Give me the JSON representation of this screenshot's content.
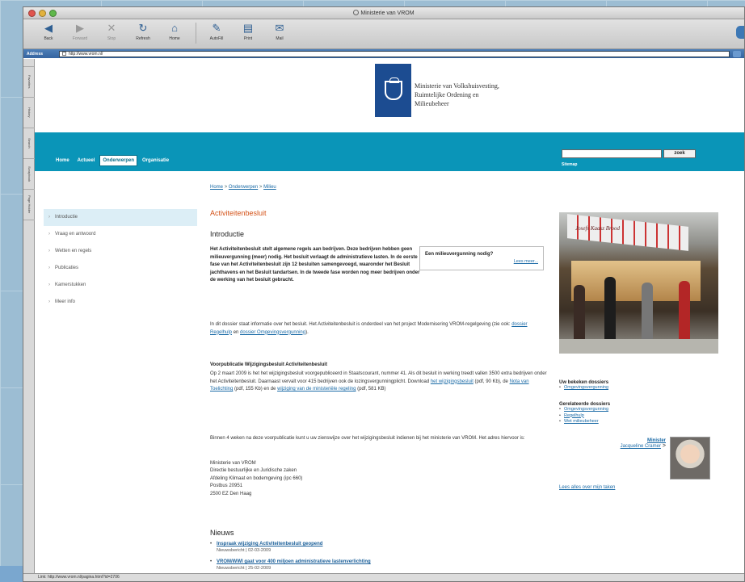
{
  "browser": {
    "window_title": "Ministerie van VROM",
    "toolbar": [
      {
        "label": "Back",
        "icon": "back-arrow-icon",
        "enabled": true
      },
      {
        "label": "Forward",
        "icon": "forward-arrow-icon",
        "enabled": false
      },
      {
        "label": "Stop",
        "icon": "stop-icon",
        "enabled": false
      },
      {
        "label": "Refresh",
        "icon": "refresh-icon",
        "enabled": true
      },
      {
        "label": "Home",
        "icon": "home-icon",
        "enabled": true
      },
      {
        "label": "AutoFill",
        "icon": "autofill-icon",
        "enabled": true
      },
      {
        "label": "Print",
        "icon": "print-icon",
        "enabled": true
      },
      {
        "label": "Mail",
        "icon": "mail-icon",
        "enabled": true
      }
    ],
    "address_label": "Address",
    "address_value": "http://www.vrom.nl/",
    "side_tabs": [
      "Favorites",
      "History",
      "Search",
      "Scrapbook",
      "Page Holder"
    ],
    "status_text": "Link: http://www.vrom.nl/pagina.html?id=2706"
  },
  "site": {
    "ministry_name": [
      "Ministerie van Volkshuisvesting,",
      "Ruimtelijke Ordening en",
      "Milieubeheer"
    ],
    "nav": [
      {
        "label": "Home",
        "active": false
      },
      {
        "label": "Actueel",
        "active": false
      },
      {
        "label": "Onderwerpen",
        "active": true
      },
      {
        "label": "Organisatie",
        "active": false
      }
    ],
    "search_button": "zoek",
    "sitemap": "Sitemap",
    "breadcrumb": {
      "home": "Home",
      "sep1": ">",
      "onderwerpen": "Onderwerpen",
      "sep2": ">",
      "milieu": "Milieu"
    },
    "leftnav": [
      {
        "label": "Introductie",
        "active": true
      },
      {
        "label": "Vraag en antwoord",
        "active": false
      },
      {
        "label": "Wetten en regels",
        "active": false
      },
      {
        "label": "Publicaties",
        "active": false
      },
      {
        "label": "Kamerstukken",
        "active": false
      },
      {
        "label": "Meer info",
        "active": false
      }
    ],
    "page_title": "Activiteitenbesluit",
    "section_title": "Introductie",
    "intro_bold": "Het Activiteitenbesluit stelt algemene regels aan bedrijven. Deze bedrijven hebben geen milieuvergunning (meer) nodig. Het besluit verlaagt de administratieve lasten. In de eerste fase van het Activiteitenbesluit zijn 12 besluiten samengevoegd, waaronder het Besluit jachthavens en het Besluit tandartsen. In de tweede fase worden nog meer bedrijven onder de werking van het besluit gebracht.",
    "callout": {
      "question": "Een milieuvergunning nodig?",
      "more": "Lees meer..."
    },
    "para1_a": "In dit dossier staat informatie over het besluit. Het Activiteitenbesluit is onderdeel van het project Modernisering VROM-regelgeving (zie ook: ",
    "para1_link1": "dossier Regelhulp",
    "para1_b": " en ",
    "para1_link2": "dossier Omgevingsvergunning",
    "para1_c": ").",
    "para2_title": "Voorpublicatie Wijzigingsbesluit Activiteitenbesluit",
    "para2_a": "Op 2 maart 2009 is het het wijzigingsbesluit voorgepubliceerd in Staatscourant, nummer 41. Als dit besluit in werking treedt vallen 3500 extra bedrijven onder het Activiteitenbesluit. Daarnaast vervalt voor 415 bedrijven ook de lozingsvergunningplicht. Download ",
    "para2_link1": "het wijzigingsbesluit",
    "para2_b": " (pdf, 90 Kb), de ",
    "para2_link2": "Nota van Toelichting",
    "para2_c": " (pdf, 155 Kb) en de ",
    "para2_link3": "wijziging van de ministeriële regeling",
    "para2_d": " (pdf, 581 KB)",
    "para3": "Binnen 4 weken na deze voorpublicatie kunt u uw zienswijze over het wijzigingsbesluit indienen bij het ministerie van VROM. Het adres hiervoor is:",
    "address": [
      "Ministerie van VROM",
      "Directie bestuurlijke en Juridische zaken",
      "Afdeling Klimaat en bodemgeving (ipc 660)",
      "Postbus 20951",
      "2500 EZ Den Haag"
    ],
    "news_title": "Nieuws",
    "news": [
      {
        "title": "Inspraak wijziging Activiteitenbesluit geopend",
        "meta": "Nieuwsbericht | 02-03-2009"
      },
      {
        "title": "VROM/WWI gaat voor 400 miljoen administratieve lastenverlichting",
        "meta": "Nieuwsbericht | 25-02-2009"
      }
    ],
    "photo_sign": "Josefs Kaasz Brood",
    "dossiers_title": "Uw bekeken dossiers",
    "dossiers": [
      "Omgevingsvergunning"
    ],
    "related_title": "Gerelateerde dossiers",
    "related": [
      "Omgevingsvergunning",
      "Regelhulp",
      "Wet milieubeheer"
    ],
    "minister_title": "Minister",
    "minister_name": "Jacqueline Cramer",
    "minister_suffix": ">",
    "read_all": "Lees alles over mijn taken"
  },
  "colors": {
    "brand_blue": "#1c4c91",
    "nav_band": "#0a95b8",
    "title_orange": "#d4541a",
    "link": "#1a6aa6"
  }
}
